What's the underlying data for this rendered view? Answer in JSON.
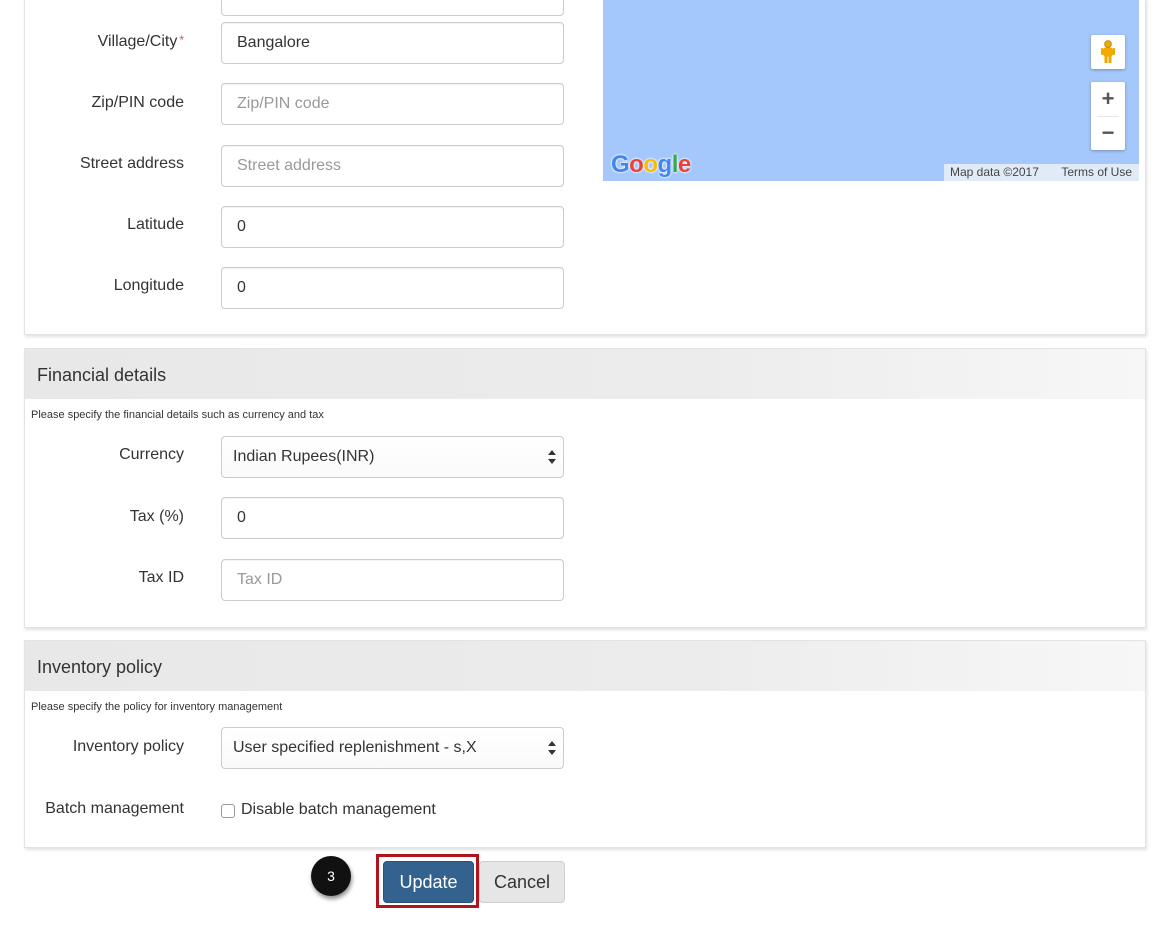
{
  "location": {
    "village_city_label": "Village/City",
    "required_marker": "*",
    "village_city_value": "Bangalore",
    "zip_label": "Zip/PIN code",
    "zip_placeholder": "Zip/PIN code",
    "street_label": "Street address",
    "street_placeholder": "Street address",
    "latitude_label": "Latitude",
    "latitude_value": "0",
    "longitude_label": "Longitude",
    "longitude_value": "0"
  },
  "map": {
    "logo": "Google",
    "map_data": "Map data ©2017",
    "terms": "Terms of Use",
    "zoom_in": "+",
    "zoom_out": "−",
    "background_color": "#a5c8fc",
    "icons": [
      "pegman-icon",
      "zoom-in-icon",
      "zoom-out-icon"
    ]
  },
  "financial": {
    "title": "Financial details",
    "description": "Please specify the financial details such as currency and tax",
    "currency_label": "Currency",
    "currency_value": "Indian Rupees(INR)",
    "tax_label": "Tax (%)",
    "tax_value": "0",
    "tax_id_label": "Tax ID",
    "tax_id_placeholder": "Tax ID"
  },
  "inventory": {
    "title": "Inventory policy",
    "description": "Please specify the policy for inventory management",
    "policy_label": "Inventory policy",
    "policy_value": "User specified replenishment - s,X",
    "batch_label": "Batch management",
    "batch_checkbox_label": "Disable batch management",
    "batch_checked": false
  },
  "actions": {
    "step_number": "3",
    "update_label": "Update",
    "cancel_label": "Cancel",
    "primary_color": "#34628f",
    "highlight_color": "#b0141c"
  }
}
